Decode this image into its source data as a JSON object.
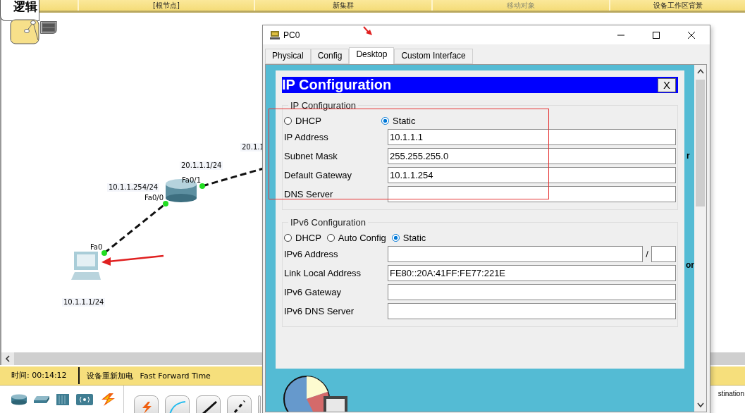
{
  "workspace_bar": {
    "tab": "逻辑",
    "items": [
      {
        "label": "[根节点]",
        "disabled": false
      },
      {
        "label": "新集群",
        "disabled": false
      },
      {
        "label": "移动对象",
        "disabled": true
      },
      {
        "label": "设备工作区背景",
        "disabled": false
      }
    ]
  },
  "topology": {
    "labels": [
      {
        "text": "10.1.1.254/24",
        "kind": "address"
      },
      {
        "text": "Fa0/0",
        "kind": "port"
      },
      {
        "text": "20.1.1.1/24",
        "kind": "address"
      },
      {
        "text": "Fa0/1",
        "kind": "port"
      },
      {
        "text": "20.1.1",
        "kind": "address"
      },
      {
        "text": "Fa0",
        "kind": "port"
      },
      {
        "text": "10.1.1.1/24",
        "kind": "address"
      }
    ]
  },
  "status_bar": {
    "time": "时间: 00:14:12",
    "power_cycle": "设备重新加电",
    "fast_forward": "Fast Forward Time"
  },
  "bottom_right_text": "stination",
  "pc_window": {
    "title": "PC0",
    "tabs": [
      {
        "label": "Physical",
        "selected": false
      },
      {
        "label": "Config",
        "selected": false
      },
      {
        "label": "Desktop",
        "selected": true
      },
      {
        "label": "Custom Interface",
        "selected": false
      }
    ],
    "desktop_fragments": [
      "r",
      "or"
    ],
    "dialog": {
      "title": "IP Configuration",
      "close": "X",
      "ipv4": {
        "legend": "IP Configuration",
        "modes": [
          {
            "label": "DHCP",
            "selected": false
          },
          {
            "label": "Static",
            "selected": true
          }
        ],
        "fields": [
          {
            "label": "IP Address",
            "value": "10.1.1.1"
          },
          {
            "label": "Subnet Mask",
            "value": "255.255.255.0"
          },
          {
            "label": "Default Gateway",
            "value": "10.1.1.254"
          },
          {
            "label": "DNS Server"
          }
        ]
      },
      "ipv6": {
        "legend": "IPv6 Configuration",
        "modes": [
          {
            "label": "DHCP",
            "selected": false
          },
          {
            "label": "Auto Config",
            "selected": false
          },
          {
            "label": "Static",
            "selected": true
          }
        ],
        "fields": [
          {
            "label": "IPv6 Address",
            "kind": "prefix",
            "separator": "/"
          },
          {
            "label": "Link Local Address",
            "value": "FE80::20A:41FF:FE77:221E"
          },
          {
            "label": "IPv6 Gateway"
          },
          {
            "label": "IPv6 DNS Server"
          }
        ]
      }
    }
  }
}
